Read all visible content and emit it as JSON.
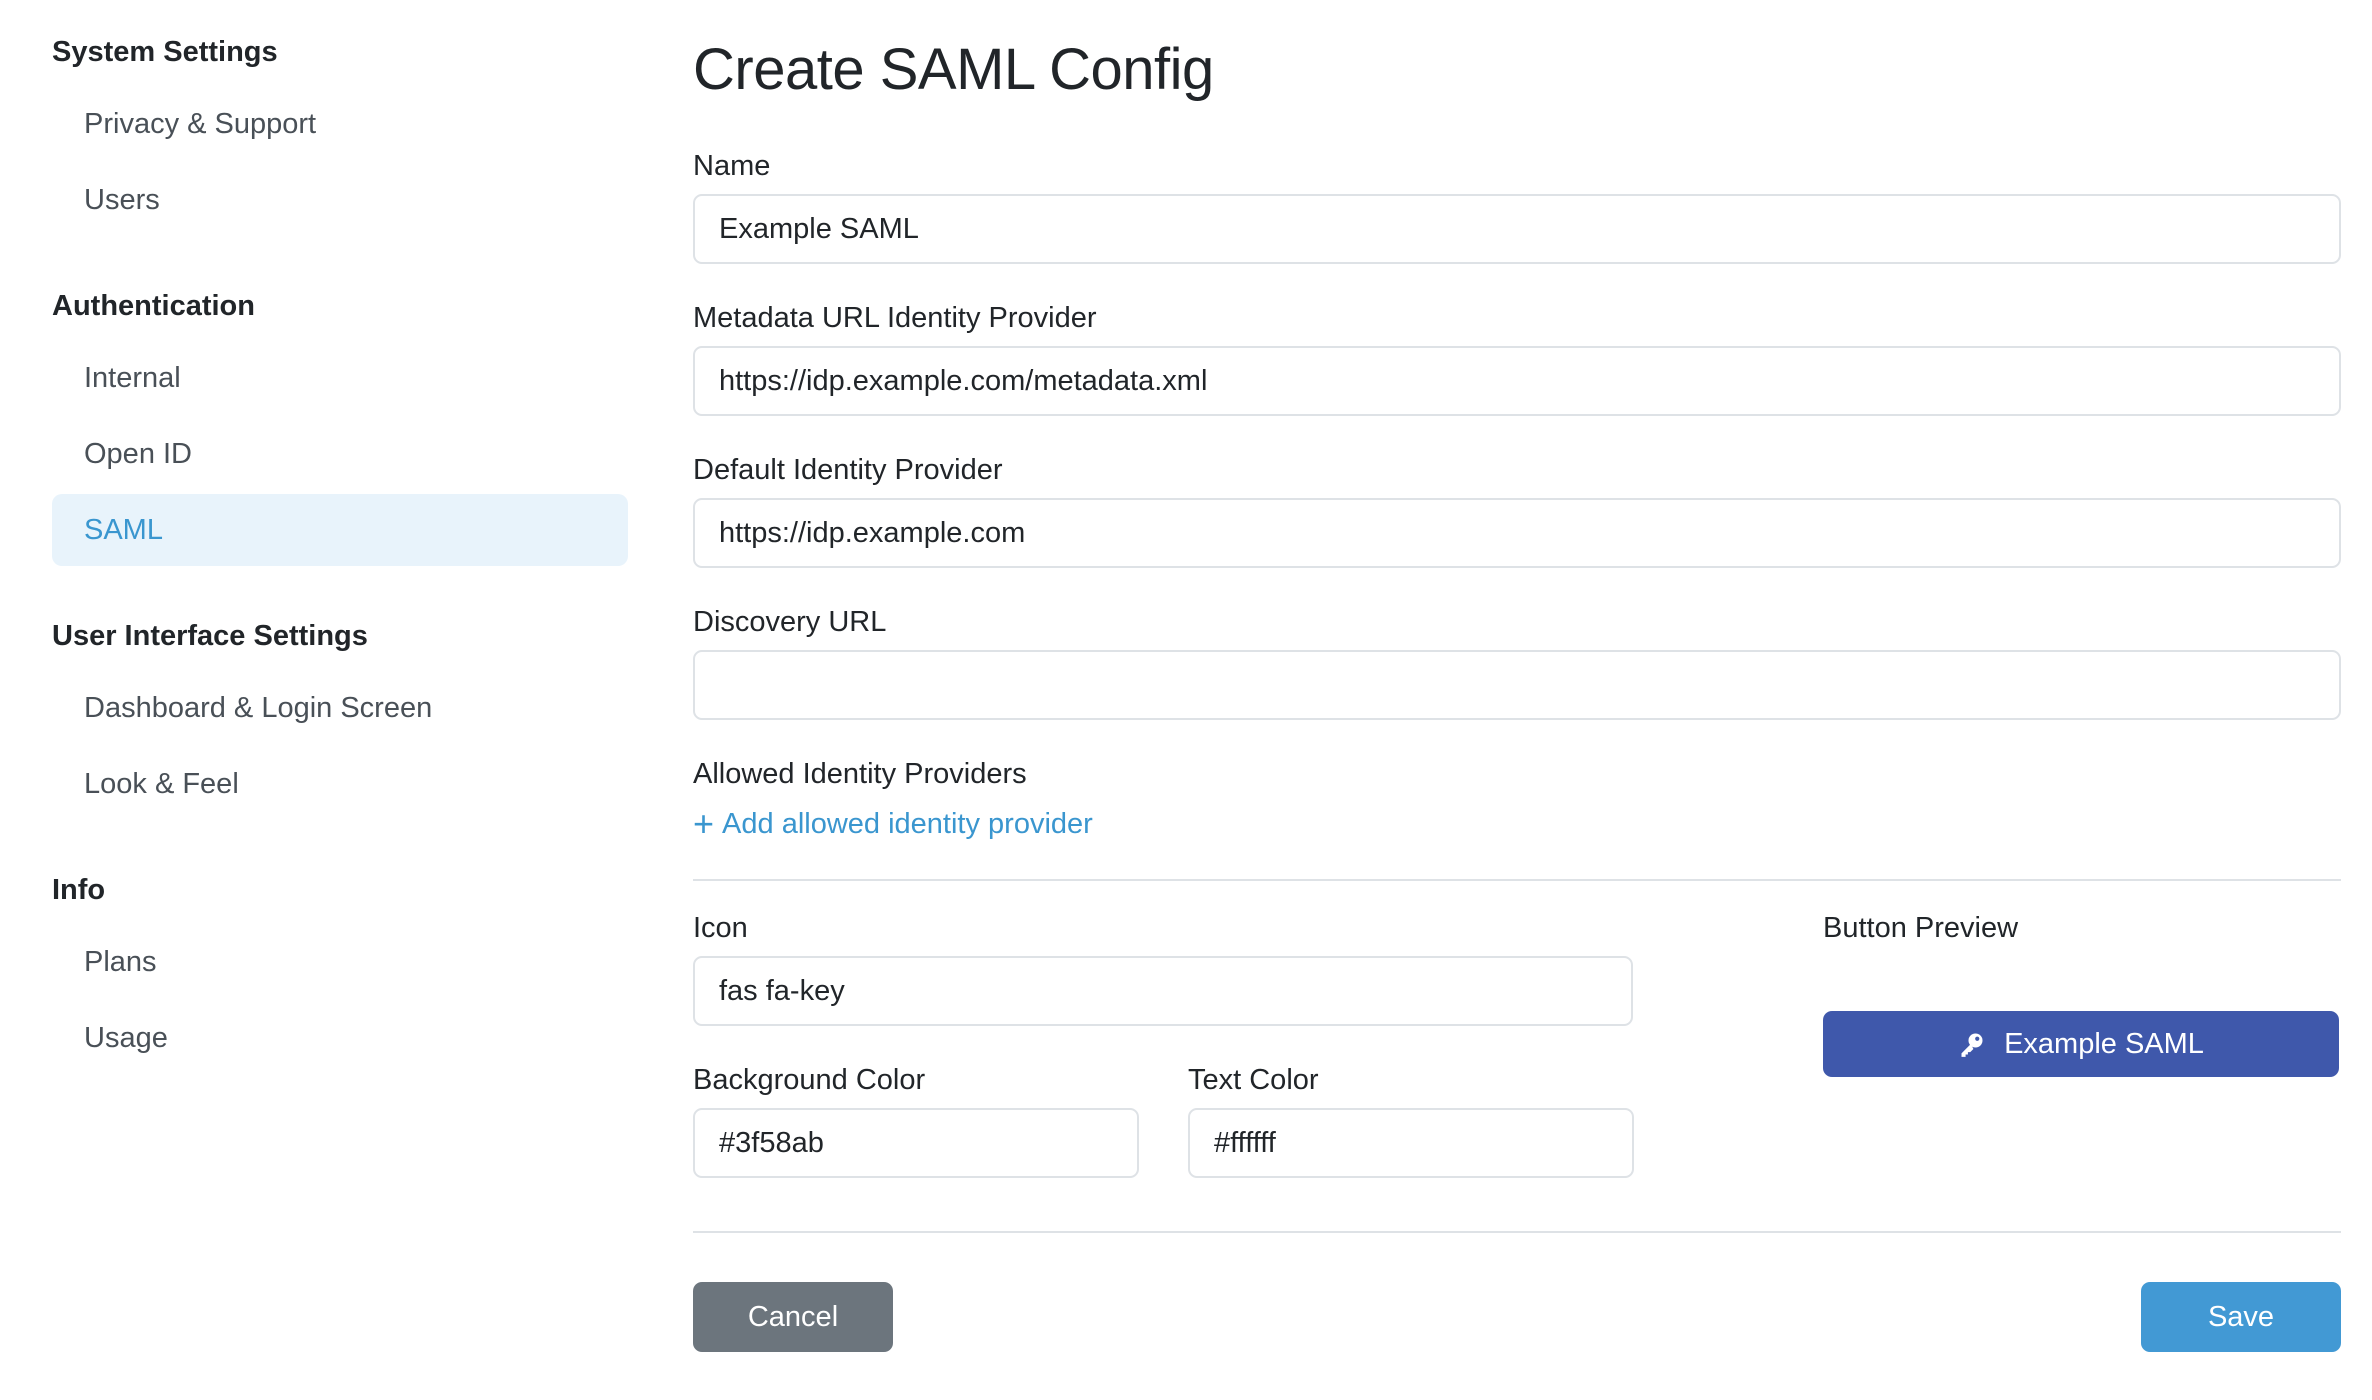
{
  "sidebar": {
    "sections": [
      {
        "heading": "System Settings",
        "items": [
          {
            "label": "Privacy & Support"
          },
          {
            "label": "Users"
          }
        ]
      },
      {
        "heading": "Authentication",
        "items": [
          {
            "label": "Internal"
          },
          {
            "label": "Open ID"
          },
          {
            "label": "SAML"
          }
        ]
      },
      {
        "heading": "User Interface Settings",
        "items": [
          {
            "label": "Dashboard & Login Screen"
          },
          {
            "label": "Look & Feel"
          }
        ]
      },
      {
        "heading": "Info",
        "items": [
          {
            "label": "Plans"
          },
          {
            "label": "Usage"
          }
        ]
      }
    ],
    "active_item": "SAML"
  },
  "form": {
    "title": "Create SAML Config",
    "name": {
      "label": "Name",
      "value": "Example SAML"
    },
    "metadata_url": {
      "label": "Metadata URL Identity Provider",
      "value": "https://idp.example.com/metadata.xml"
    },
    "default_idp": {
      "label": "Default Identity Provider",
      "value": "https://idp.example.com"
    },
    "discovery_url": {
      "label": "Discovery URL",
      "value": ""
    },
    "allowed_idps": {
      "label": "Allowed Identity Providers",
      "add_link": "Add allowed identity provider"
    },
    "icon": {
      "label": "Icon",
      "value": "fas fa-key"
    },
    "background_color": {
      "label": "Background Color",
      "value": "#3f58ab"
    },
    "text_color": {
      "label": "Text Color",
      "value": "#ffffff"
    },
    "preview": {
      "label": "Button Preview",
      "button_text": "Example SAML",
      "icon": "key-icon"
    },
    "cancel_label": "Cancel",
    "save_label": "Save"
  },
  "colors": {
    "accent": "#3a96cf",
    "active_bg": "#e8f3fb",
    "preview_bg": "#3f58ab",
    "preview_text": "#ffffff",
    "cancel_bg": "#6c757d",
    "save_bg": "#4299d4"
  }
}
